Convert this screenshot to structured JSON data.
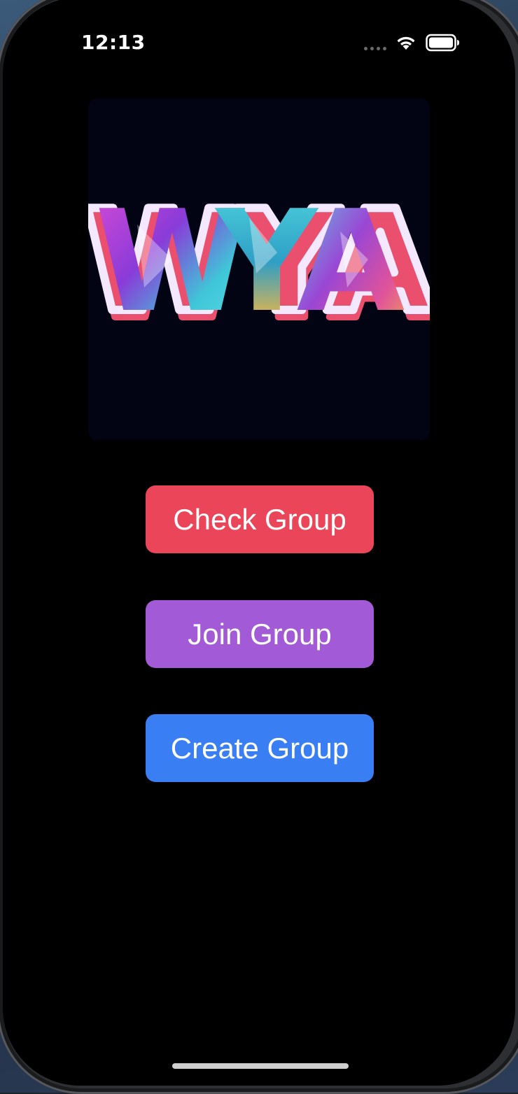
{
  "status_bar": {
    "time": "12:13",
    "icons": [
      "signal-dots-icon",
      "wifi-icon",
      "battery-icon"
    ]
  },
  "logo": {
    "text": "WYA",
    "background": "#020313"
  },
  "buttons": {
    "check": {
      "label": "Check Group",
      "color": "#ea4559"
    },
    "join": {
      "label": "Join Group",
      "color": "#a35ad6"
    },
    "create": {
      "label": "Create Group",
      "color": "#3a7ef3"
    }
  }
}
